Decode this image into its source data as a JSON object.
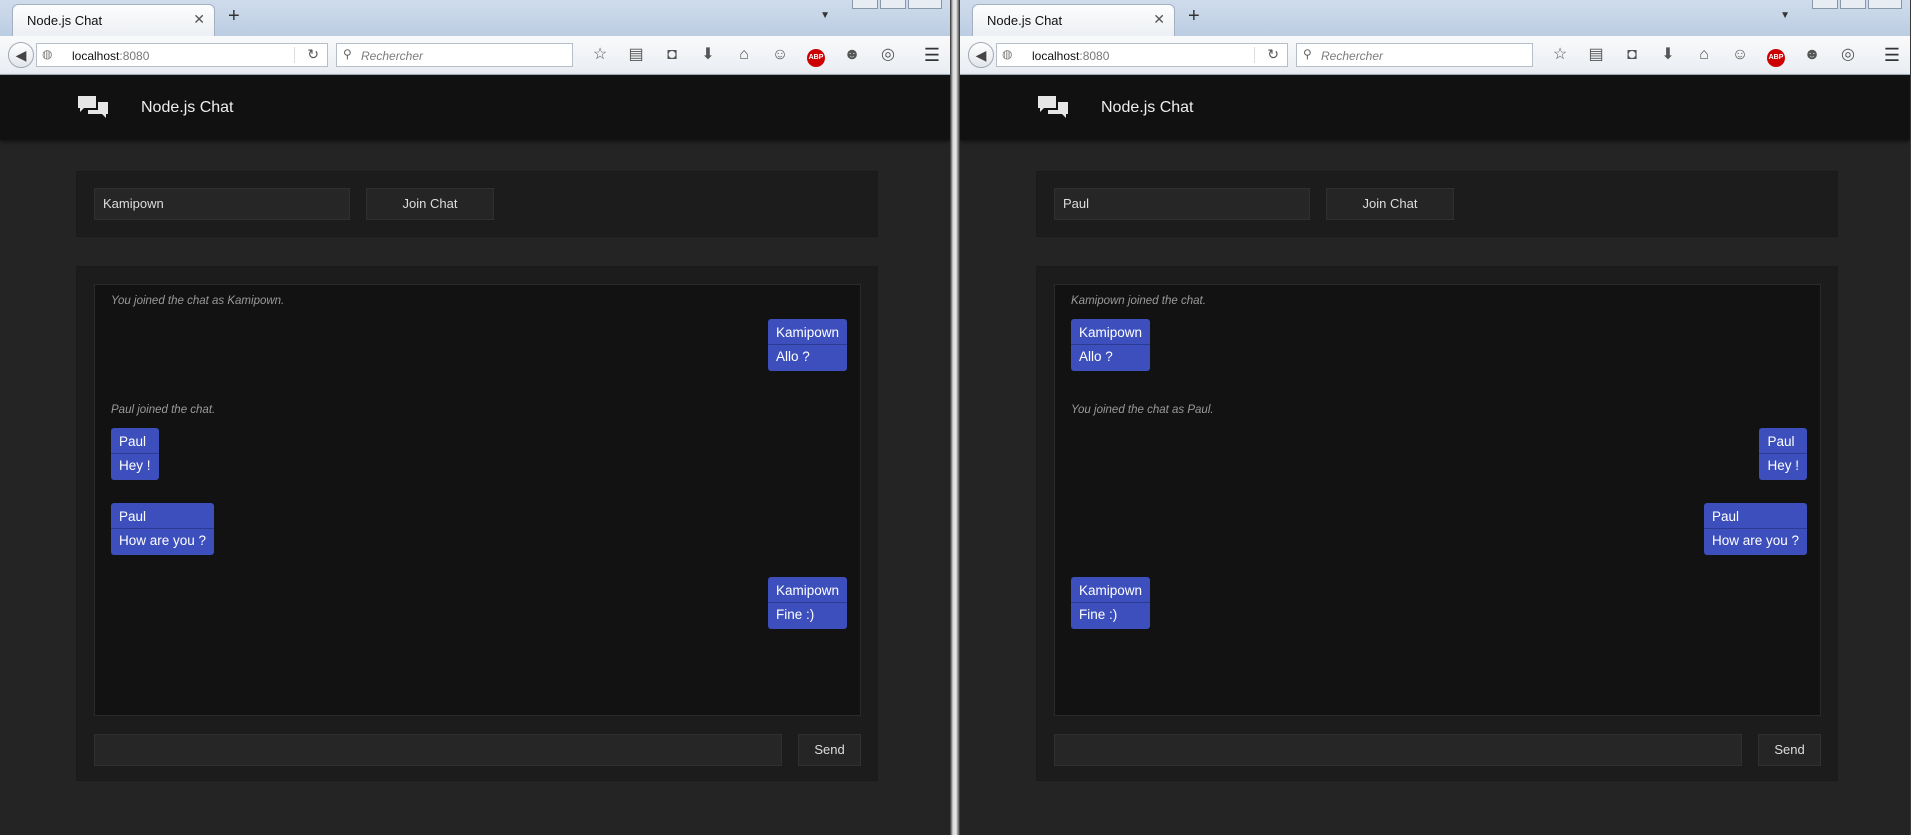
{
  "left": {
    "browser": {
      "tab_title": "Node.js Chat",
      "url_host": "localhost",
      "url_port": ":8080",
      "search_placeholder": "Rechercher"
    },
    "app": {
      "title": "Node.js Chat",
      "username_value": "Kamipown",
      "join_label": "Join Chat",
      "send_label": "Send",
      "messages": [
        {
          "kind": "system",
          "text": "You joined the chat as Kamipown."
        },
        {
          "kind": "bubble",
          "author": "Kamipown",
          "text": "Allo ?",
          "align": "right"
        },
        {
          "kind": "system",
          "text": "Paul joined the chat."
        },
        {
          "kind": "bubble",
          "author": "Paul",
          "text": "Hey !",
          "align": "left"
        },
        {
          "kind": "bubble",
          "author": "Paul",
          "text": "How are you ?",
          "align": "left"
        },
        {
          "kind": "bubble",
          "author": "Kamipown",
          "text": "Fine :)",
          "align": "right"
        }
      ]
    }
  },
  "right": {
    "browser": {
      "tab_title": "Node.js Chat",
      "url_host": "localhost",
      "url_port": ":8080",
      "search_placeholder": "Rechercher"
    },
    "app": {
      "title": "Node.js Chat",
      "username_value": "Paul",
      "join_label": "Join Chat",
      "send_label": "Send",
      "messages": [
        {
          "kind": "system",
          "text": "Kamipown joined the chat."
        },
        {
          "kind": "bubble",
          "author": "Kamipown",
          "text": "Allo ?",
          "align": "left"
        },
        {
          "kind": "system",
          "text": "You joined the chat as Paul."
        },
        {
          "kind": "bubble",
          "author": "Paul",
          "text": "Hey !",
          "align": "right"
        },
        {
          "kind": "bubble",
          "author": "Paul",
          "text": "How are you ?",
          "align": "right"
        },
        {
          "kind": "bubble",
          "author": "Kamipown",
          "text": "Fine :)",
          "align": "left"
        }
      ]
    }
  },
  "colors": {
    "bubble": "#3d4fbd",
    "navbar": "#111111",
    "page_bg": "#242424",
    "abp_red": "#cc0000"
  },
  "icons": [
    "back-arrow-icon",
    "globe-icon",
    "reload-icon",
    "search-icon",
    "bookmark-star-icon",
    "reading-list-icon",
    "pocket-icon",
    "download-icon",
    "home-icon",
    "hello-chat-icon",
    "adblock-plus-icon",
    "persona-icon",
    "sync-icon",
    "menu-hamburger-icon",
    "chat-bubbles-icon"
  ]
}
